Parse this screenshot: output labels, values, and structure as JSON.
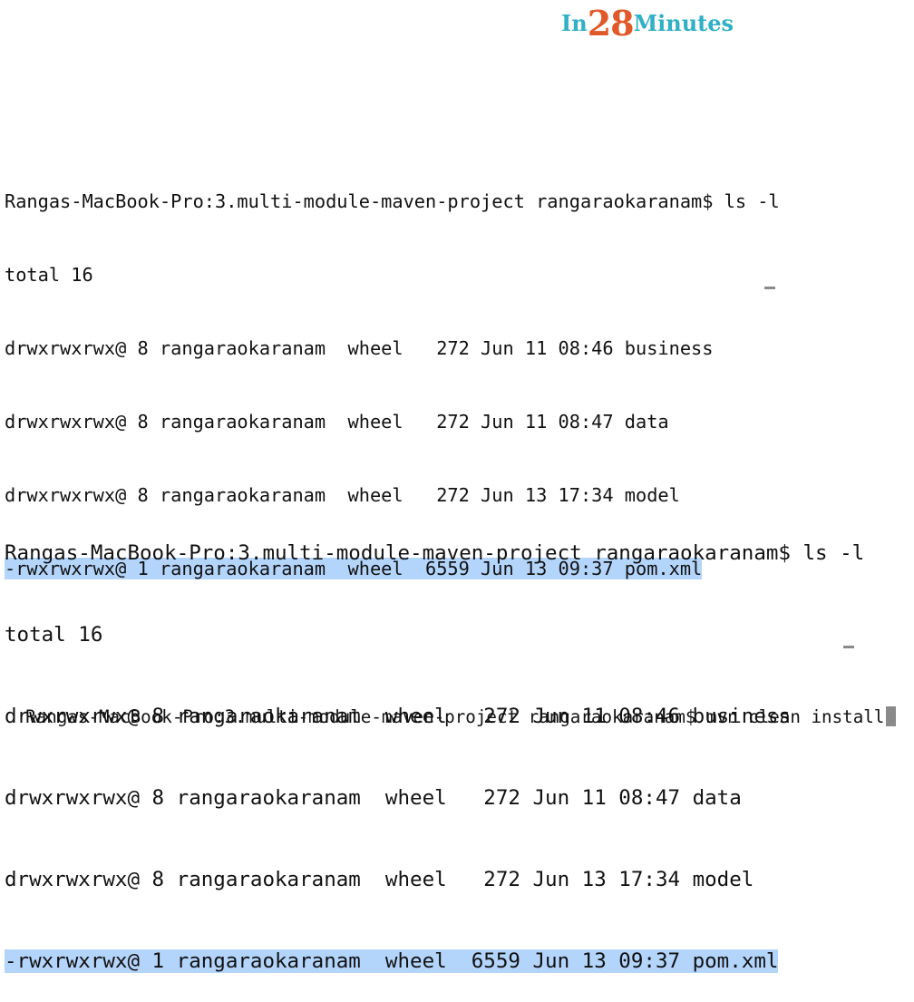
{
  "logo": {
    "prefix": "In",
    "number": "28",
    "suffix": "Minutes"
  },
  "listing_top": {
    "prompt": "Rangas-MacBook-Pro:3.multi-module-maven-project rangaraokaranam$ ls -l",
    "total": "total 16",
    "rows": [
      "drwxrwxrwx@ 8 rangaraokaranam  wheel   272 Jun 11 08:46 business",
      "drwxrwxrwx@ 8 rangaraokaranam  wheel   272 Jun 11 08:47 data",
      "drwxrwxrwx@ 8 rangaraokaranam  wheel   272 Jun 13 17:34 model",
      "-rwxrwxrwx@ 1 rangaraokaranam  wheel  6559 Jun 13 09:37 pom.xml"
    ]
  },
  "listing_bottom": {
    "prompt": "Rangas-MacBook-Pro:3.multi-module-maven-project rangaraokaranam$ ls -l",
    "total": "total 16",
    "rows": [
      "drwxrwxrwx@ 8 rangaraokaranam  wheel   272 Jun 11 08:46 business",
      "drwxrwxrwx@ 8 rangaraokaranam  wheel   272 Jun 11 08:47 data",
      "drwxrwxrwx@ 8 rangaraokaranam  wheel   272 Jun 13 17:34 model",
      "-rwxrwxrwx@ 1 rangaraokaranam  wheel  6559 Jun 13 09:37 pom.xml"
    ]
  },
  "command_line": {
    "text": "Rangas-MacBook-Pro:3.multi-module-maven-project rangaraokaranam$ mvn clean install"
  },
  "colors": {
    "highlight": "#b4d5fb",
    "logo_blue": "#2fb0c4",
    "logo_orange": "#e1592a"
  }
}
